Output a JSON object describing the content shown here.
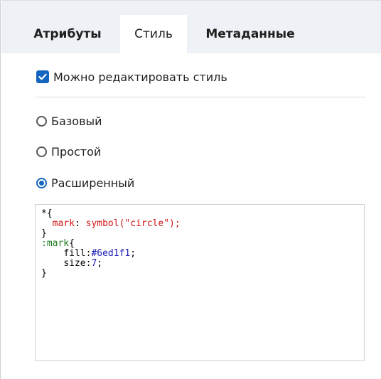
{
  "tabs": [
    {
      "label": "Атрибуты",
      "active": false
    },
    {
      "label": "Стиль",
      "active": true
    },
    {
      "label": "Метаданные",
      "active": false
    }
  ],
  "editable_checkbox": {
    "label": "Можно редактировать стиль",
    "checked": true
  },
  "style_modes": [
    {
      "label": "Базовый",
      "selected": false
    },
    {
      "label": "Простой",
      "selected": false
    },
    {
      "label": "Расширенный",
      "selected": true
    }
  ],
  "code": {
    "line1_open": "*{",
    "line2_prop": "mark",
    "line2_colon": ": ",
    "line2_value": "symbol(\"circle\");",
    "line3_close": "}",
    "line4_selector": ":mark",
    "line4_brace": "{",
    "line5_prop": "fill:",
    "line5_value": "#6ed1f1",
    "line5_semi": ";",
    "line6_prop": "size:",
    "line6_value": "7",
    "line6_semi": ";",
    "line7_close": "}"
  },
  "colors": {
    "accent": "#1565c0",
    "code_property": "#d01515",
    "code_selector": "#1d7a1d",
    "code_value": "#1a1ab8"
  }
}
